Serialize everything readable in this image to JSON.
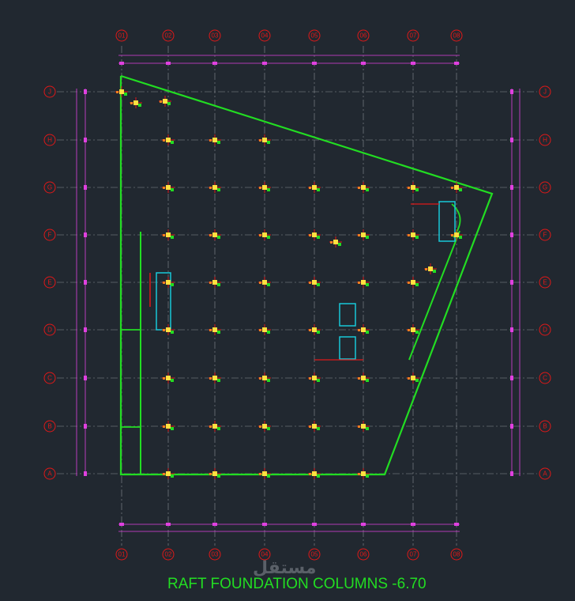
{
  "title": "RAFT FOUNDATION COLUMNS  -6.70",
  "watermark": "مستقل",
  "grid": {
    "columns": [
      "01",
      "02",
      "03",
      "04",
      "05",
      "06",
      "07",
      "08"
    ],
    "rows": [
      "J",
      "H",
      "G",
      "F",
      "E",
      "D",
      "C",
      "B",
      "A"
    ]
  },
  "colors": {
    "background": "#212830",
    "grid_bubble": "#e01818",
    "outline": "#22dd22",
    "dimension": "#e040e0",
    "gridline": "#8a8f94",
    "core_wall": "#18c8d8",
    "column_fill": "#ffe040"
  }
}
